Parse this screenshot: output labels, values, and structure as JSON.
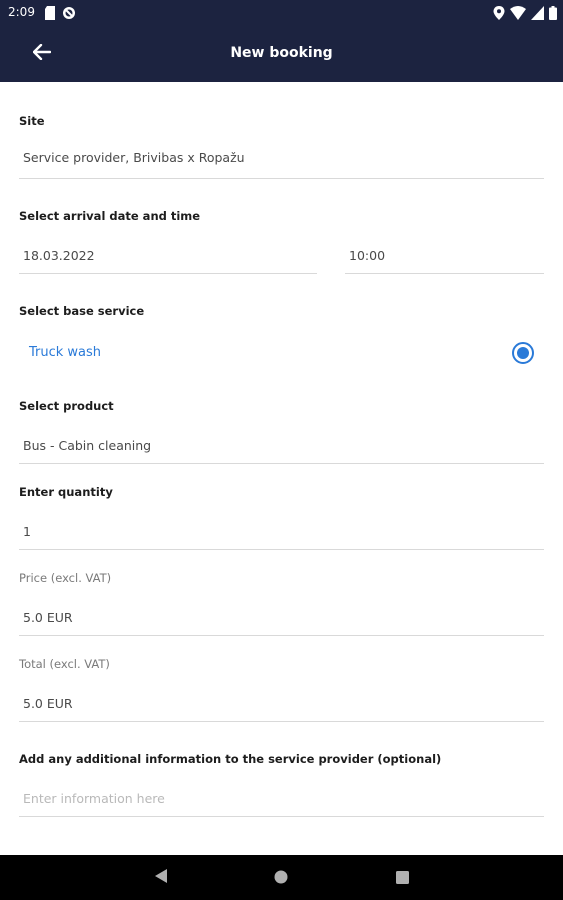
{
  "status_bar": {
    "time": "2:09",
    "icons_left": [
      "sd-card-icon",
      "blocked-icon"
    ],
    "icons_right": [
      "location-icon",
      "wifi-icon",
      "signal-icon",
      "battery-icon"
    ]
  },
  "app_bar": {
    "title": "New booking",
    "back_icon": "arrow-left-icon"
  },
  "form": {
    "site": {
      "label": "Site",
      "value": "Service provider, Brivibas x Ropažu"
    },
    "arrival": {
      "label": "Select arrival date and time",
      "date": "18.03.2022",
      "time": "10:00"
    },
    "base_service": {
      "label": "Select base service",
      "option": "Truck wash",
      "selected": true
    },
    "product": {
      "label": "Select product",
      "value": "Bus - Cabin cleaning"
    },
    "quantity": {
      "label": "Enter quantity",
      "value": "1"
    },
    "price": {
      "label": "Price (excl. VAT)",
      "value": "5.0 EUR"
    },
    "total": {
      "label": "Total (excl. VAT)",
      "value": "5.0 EUR"
    },
    "additional_info": {
      "label": "Add any additional information to the service provider (optional)",
      "placeholder": "Enter information here"
    }
  },
  "colors": {
    "app_bar": "#1c2340",
    "accent": "#2a7ad8",
    "nav_bar": "#000000"
  }
}
